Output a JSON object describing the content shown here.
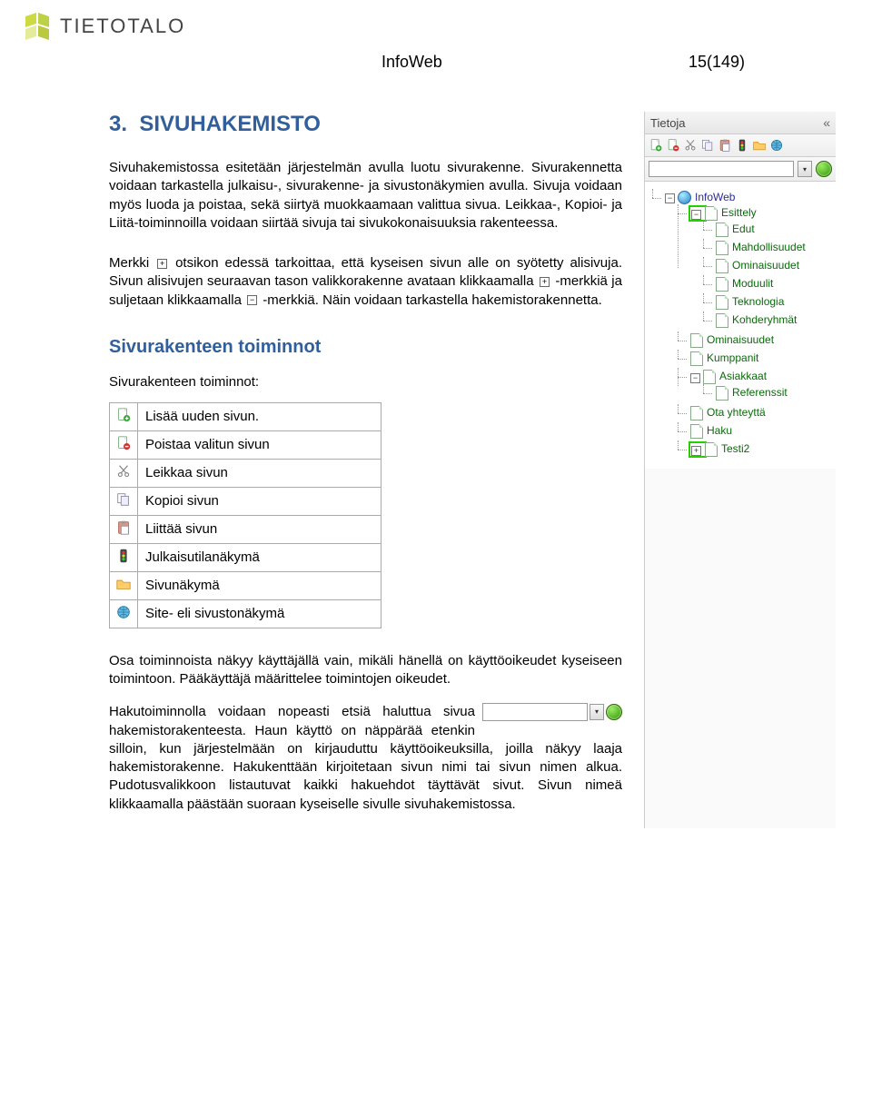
{
  "brand": {
    "name": "TIETOTALO"
  },
  "doc": {
    "title": "InfoWeb",
    "page": "15(149)"
  },
  "section": {
    "number": "3.",
    "title": "SIVUHAKEMISTO",
    "p1": "Sivuhakemistossa esitetään järjestelmän avulla luotu sivurakenne. Sivurakennetta voidaan tarkastella julkaisu-, sivurakenne- ja sivustonäkymien avulla. Sivuja voidaan myös luoda ja poistaa, sekä siirtyä muokkaamaan valittua sivua. Leikkaa-, Kopioi- ja Liitä-toiminnoilla voidaan siirtää sivuja tai sivukokonaisuuksia rakenteessa.",
    "p2a": "Merkki ",
    "p2b": " otsikon edessä tarkoittaa, että kyseisen sivun alle on syötetty alisivuja. Sivun alisivujen seuraavan tason valikkorakenne avataan klikkaamalla ",
    "p2c": " -merkkiä ja suljetaan klikkaamalla ",
    "p2d": " -merkkiä. Näin voidaan tarkastella hakemistorakennetta."
  },
  "subsection": {
    "title": "Sivurakenteen toiminnot",
    "caption": "Sivurakenteen toiminnot:"
  },
  "actions": [
    {
      "label": "Lisää uuden sivun.",
      "icon": "page-add"
    },
    {
      "label": "Poistaa valitun sivun",
      "icon": "page-remove"
    },
    {
      "label": "Leikkaa sivun",
      "icon": "cut"
    },
    {
      "label": "Kopioi sivun",
      "icon": "copy"
    },
    {
      "label": "Liittää sivun",
      "icon": "paste"
    },
    {
      "label": "Julkaisutilanäkymä",
      "icon": "traffic"
    },
    {
      "label": "Sivunäkymä",
      "icon": "folder"
    },
    {
      "label": "Site- eli sivustonäkymä",
      "icon": "globe"
    }
  ],
  "bottom": {
    "p1": "Osa toiminnoista näkyy käyttäjällä vain, mikäli hänellä on käyttöoikeudet kyseiseen toimintoon. Pääkäyttäjä määrittelee toimintojen oikeudet.",
    "p2": "Hakutoiminnolla voidaan nopeasti etsiä haluttua sivua hakemistorakenteesta. Haun käyttö on näppärää etenkin silloin, kun järjestelmään on kirjauduttu käyttöoikeuksilla, joilla näkyy laaja hakemistorakenne. Hakukenttään kirjoitetaan sivun nimi tai sivun nimen alkua. Pudotusvalikkoon listautuvat kaikki hakuehdot täyttävät sivut. Sivun nimeä klikkaamalla päästään suoraan kyseiselle sivulle sivuhakemistossa."
  },
  "panel": {
    "title": "Tietoja",
    "search_placeholder": "",
    "tree": {
      "root": "InfoWeb",
      "items": [
        {
          "label": "Esittely",
          "expanded": true,
          "highlight": true,
          "children": [
            {
              "label": "Edut"
            },
            {
              "label": "Mahdollisuudet"
            },
            {
              "label": "Ominaisuudet"
            },
            {
              "label": "Moduulit"
            },
            {
              "label": "Teknologia"
            },
            {
              "label": "Kohderyhmät"
            }
          ]
        },
        {
          "label": "Ominaisuudet"
        },
        {
          "label": "Kumppanit"
        },
        {
          "label": "Asiakkaat",
          "expanded": true,
          "children": [
            {
              "label": "Referenssit"
            }
          ]
        },
        {
          "label": "Ota yhteyttä"
        },
        {
          "label": "Haku"
        },
        {
          "label": "Testi2",
          "collapsed": true,
          "highlight": true
        }
      ]
    }
  }
}
